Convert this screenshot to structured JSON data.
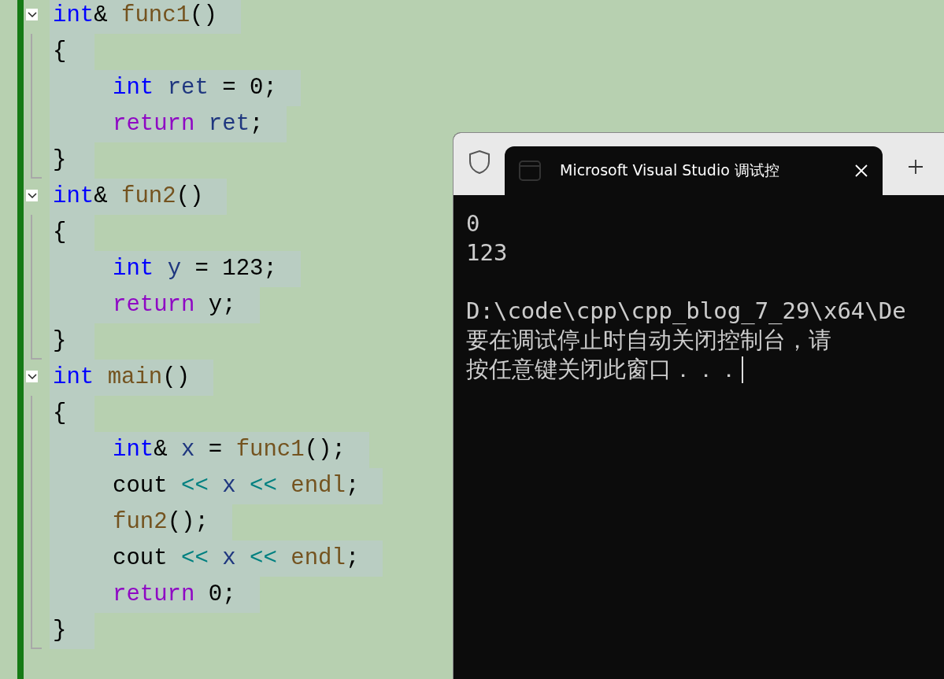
{
  "editor": {
    "functions": [
      {
        "expanded": true,
        "header": [
          [
            {
              "text": "int",
              "kind": "keyword"
            },
            {
              "text": "&",
              "kind": "plain"
            }
          ],
          [
            {
              "text": "func1",
              "kind": "function"
            },
            {
              "text": "()",
              "kind": "plain"
            }
          ]
        ],
        "open_brace": "{",
        "statements": [
          [
            [
              {
                "text": "int",
                "kind": "keyword"
              }
            ],
            [
              {
                "text": "ret",
                "kind": "variable"
              }
            ],
            [
              {
                "text": "= 0;",
                "kind": "plain"
              }
            ]
          ],
          [
            [
              {
                "text": "return",
                "kind": "control"
              }
            ],
            [
              {
                "text": "ret",
                "kind": "variable"
              },
              {
                "text": ";",
                "kind": "plain"
              }
            ]
          ]
        ],
        "close_brace": "}"
      },
      {
        "expanded": true,
        "header": [
          [
            {
              "text": "int",
              "kind": "keyword"
            },
            {
              "text": "&",
              "kind": "plain"
            }
          ],
          [
            {
              "text": "fun2",
              "kind": "function"
            },
            {
              "text": "()",
              "kind": "plain"
            }
          ]
        ],
        "open_brace": "{",
        "statements": [
          [
            [
              {
                "text": "int",
                "kind": "keyword"
              }
            ],
            [
              {
                "text": "y",
                "kind": "variable"
              }
            ],
            [
              {
                "text": "= 123;",
                "kind": "plain"
              }
            ]
          ],
          [
            [
              {
                "text": "return",
                "kind": "control"
              }
            ],
            [
              {
                "text": "y;",
                "kind": "plain"
              }
            ]
          ]
        ],
        "close_brace": "}"
      },
      {
        "expanded": true,
        "header": [
          [
            {
              "text": "int",
              "kind": "keyword"
            }
          ],
          [
            {
              "text": "main",
              "kind": "function"
            },
            {
              "text": "()",
              "kind": "plain"
            }
          ]
        ],
        "open_brace": "{",
        "statements": [
          [
            [
              {
                "text": "int",
                "kind": "keyword"
              },
              {
                "text": "&",
                "kind": "plain"
              }
            ],
            [
              {
                "text": "x",
                "kind": "variable"
              }
            ],
            [
              {
                "text": "=",
                "kind": "plain"
              }
            ],
            [
              {
                "text": "func1",
                "kind": "function"
              },
              {
                "text": "();",
                "kind": "plain"
              }
            ]
          ],
          [
            [
              {
                "text": "cout",
                "kind": "plain"
              }
            ],
            [
              {
                "text": "<<",
                "kind": "operator"
              }
            ],
            [
              {
                "text": "x",
                "kind": "variable"
              }
            ],
            [
              {
                "text": "<<",
                "kind": "operator"
              }
            ],
            [
              {
                "text": "endl",
                "kind": "function"
              },
              {
                "text": ";",
                "kind": "plain"
              }
            ]
          ],
          [
            [
              {
                "text": "fun2",
                "kind": "function"
              },
              {
                "text": "();",
                "kind": "plain"
              }
            ]
          ],
          [
            [
              {
                "text": "cout",
                "kind": "plain"
              }
            ],
            [
              {
                "text": "<<",
                "kind": "operator"
              }
            ],
            [
              {
                "text": "x",
                "kind": "variable"
              }
            ],
            [
              {
                "text": "<<",
                "kind": "operator"
              }
            ],
            [
              {
                "text": "endl",
                "kind": "function"
              },
              {
                "text": ";",
                "kind": "plain"
              }
            ]
          ],
          [
            [
              {
                "text": "return",
                "kind": "control"
              }
            ],
            [
              {
                "text": "0;",
                "kind": "plain"
              }
            ]
          ]
        ],
        "close_brace": "}"
      }
    ]
  },
  "console": {
    "tab": {
      "title": "Microsoft Visual Studio 调试控"
    },
    "output": [
      "0",
      "123"
    ],
    "messages": [
      "D:\\code\\cpp\\cpp_blog_7_29\\x64\\De",
      "要在调试停止时自动关闭控制台，请",
      "按任意键关闭此窗口．．．"
    ]
  }
}
